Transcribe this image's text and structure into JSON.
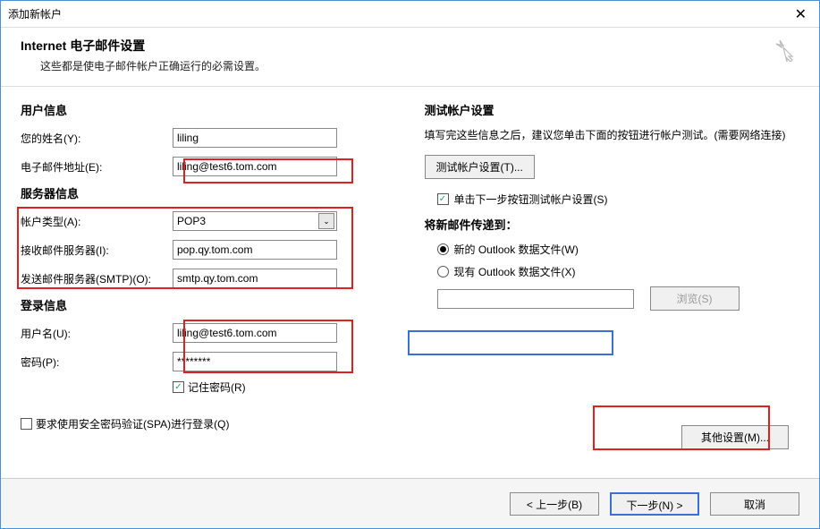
{
  "window": {
    "title": "添加新帐户"
  },
  "header": {
    "title": "Internet 电子邮件设置",
    "subtitle": "这些都是使电子邮件帐户正确运行的必需设置。"
  },
  "user_info": {
    "section": "用户信息",
    "name_label": "您的姓名(Y):",
    "name_value": "liling",
    "email_label": "电子邮件地址(E):",
    "email_value": "liling@test6.tom.com"
  },
  "server_info": {
    "section": "服务器信息",
    "type_label": "帐户类型(A):",
    "type_value": "POP3",
    "incoming_label": "接收邮件服务器(I):",
    "incoming_value": "pop.qy.tom.com",
    "smtp_label": "发送邮件服务器(SMTP)(O):",
    "smtp_value": "smtp.qy.tom.com"
  },
  "login_info": {
    "section": "登录信息",
    "user_label": "用户名(U):",
    "user_value": "liling@test6.tom.com",
    "pass_label": "密码(P):",
    "pass_value": "********",
    "remember": "记住密码(R)",
    "spa": "要求使用安全密码验证(SPA)进行登录(Q)"
  },
  "test": {
    "section": "测试帐户设置",
    "desc": "填写完这些信息之后，建议您单击下面的按钮进行帐户测试。(需要网络连接)",
    "btn": "测试帐户设置(T)...",
    "auto_test": "单击下一步按钮测试帐户设置(S)"
  },
  "deliver": {
    "section": "将新邮件传递到：",
    "new_file": "新的 Outlook 数据文件(W)",
    "existing": "现有 Outlook 数据文件(X)",
    "browse": "浏览(S)"
  },
  "other_btn": "其他设置(M)...",
  "footer": {
    "back": "< 上一步(B)",
    "next": "下一步(N) >",
    "cancel": "取消"
  }
}
